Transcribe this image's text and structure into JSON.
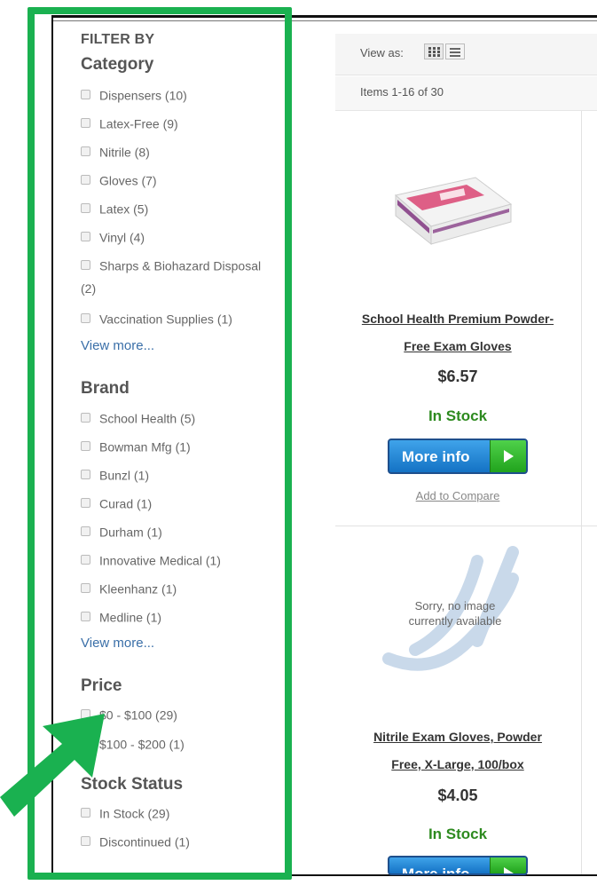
{
  "sidebar": {
    "filter_by": "FILTER BY",
    "category": {
      "title": "Category",
      "items": [
        {
          "label": "Dispensers (10)"
        },
        {
          "label": "Latex-Free (9)"
        },
        {
          "label": "Nitrile (8)"
        },
        {
          "label": "Gloves (7)"
        },
        {
          "label": "Latex (5)"
        },
        {
          "label": "Vinyl (4)"
        },
        {
          "label": "Sharps & Biohazard Disposal",
          "cont": "(2)"
        },
        {
          "label": "Vaccination Supplies (1)"
        }
      ],
      "view_more": "View more..."
    },
    "brand": {
      "title": "Brand",
      "items": [
        {
          "label": "School Health (5)"
        },
        {
          "label": "Bowman Mfg (1)"
        },
        {
          "label": "Bunzl (1)"
        },
        {
          "label": "Curad (1)"
        },
        {
          "label": "Durham (1)"
        },
        {
          "label": "Innovative Medical (1)"
        },
        {
          "label": "Kleenhanz (1)"
        },
        {
          "label": "Medline (1)"
        }
      ],
      "view_more": "View more..."
    },
    "price": {
      "title": "Price",
      "items": [
        {
          "label": "$0 - $100 (29)"
        },
        {
          "label": "$100 - $200 (1)"
        }
      ]
    },
    "stock_status": {
      "title": "Stock Status",
      "items": [
        {
          "label": "In Stock (29)"
        },
        {
          "label": "Discontinued (1)"
        }
      ]
    }
  },
  "toolbar": {
    "view_as": "View as:",
    "items_count": "Items 1-16 of 30"
  },
  "products": [
    {
      "name_line1": "School Health Premium Powder-",
      "name_line2": "Free Exam Gloves",
      "price": "$6.57",
      "stock": "In Stock",
      "more_info": "More info",
      "compare": "Add to Compare"
    },
    {
      "name_line1": "Nitrile Exam Gloves, Powder",
      "name_line2": "Free, X-Large, 100/box",
      "price": "$4.05",
      "stock": "In Stock",
      "more_info": "More info",
      "no_image_text": "Sorry, no image currently available"
    }
  ],
  "colors": {
    "highlight": "#1ab150",
    "link": "#3a6fa8",
    "in_stock": "#2d8a1f",
    "button_blue": "#1472c4",
    "button_green": "#21a31d"
  }
}
